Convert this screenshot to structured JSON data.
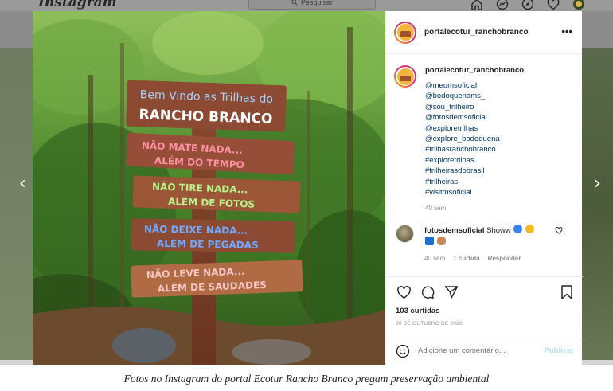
{
  "topbar": {
    "brand": "Instagram",
    "search_placeholder": "Pesquisar",
    "nav_icons": [
      "home-icon",
      "messenger-icon",
      "explore-icon",
      "heart-icon",
      "profile-icon"
    ]
  },
  "post": {
    "author": "portalecotur_ranchobranco",
    "more_symbol": "•••",
    "photo_signs": [
      "Bem Vindo as Trilhas do",
      "RANCHO BRANCO",
      "NÃO MATE NADA...",
      "ALÉM DO TEMPO",
      "NÃO TIRE NADA...",
      "ALÉM DE FOTOS",
      "NÃO DEIXE NADA...",
      "ALÉM DE PEGADAS",
      "NÃO LEVE NADA...",
      "ALÉM DE SAUDADES"
    ],
    "caption": {
      "user": "portalecotur_ranchobranco",
      "tags": [
        "@meumsoficial",
        "@bodoquenams_",
        "@sou_trilheiro",
        "@fotosdemsoficial",
        "@exploretrilhas",
        "@explore_bodoquena",
        "#trilhasranchobranco",
        "#exploretrilhas",
        "#trilheirasdobrasil",
        "#trilheiras",
        "#visitmsoficial"
      ],
      "time": "40 sem"
    },
    "comment": {
      "user": "fotosdemsoficial",
      "text": "Showw",
      "time": "40 sem",
      "likes": "1 curtida",
      "reply": "Responder"
    },
    "likes": "103 curtidas",
    "date": "20 DE OUTUBRO DE 2020",
    "add_comment_placeholder": "Adicione um comentário...",
    "publish_label": "Publicar"
  },
  "nav_arrows": {
    "prev": "‹",
    "next": "›"
  },
  "figure_caption": "Fotos no Instagram do portal Ecotur Rancho Branco pregam preservação ambiental",
  "colors": {
    "link": "#00376b",
    "publish_disabled": "#b2dffc",
    "muted": "#8e8e8e",
    "backdrop": "#8c8c8c"
  }
}
